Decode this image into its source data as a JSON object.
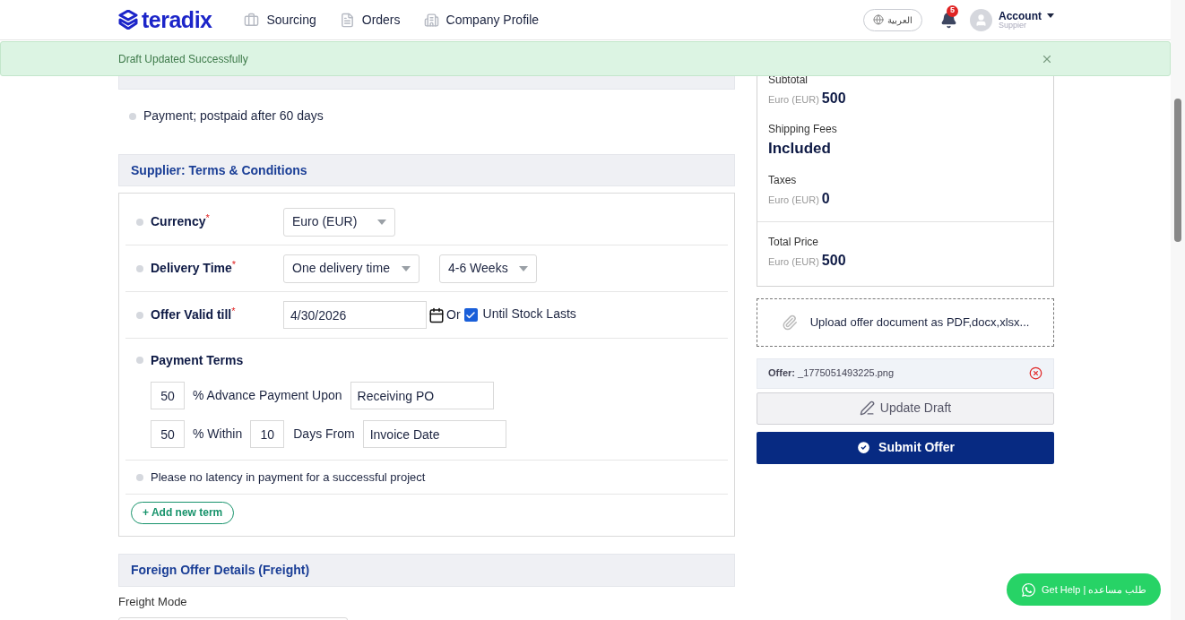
{
  "nav": {
    "brand": "teradix",
    "links": [
      {
        "label": "Sourcing",
        "kind": "briefcase"
      },
      {
        "label": "Orders",
        "kind": "document"
      },
      {
        "label": "Company Profile",
        "kind": "building"
      }
    ],
    "language": "العربية",
    "notifications": "5",
    "account": {
      "name": "Account",
      "role": "Suppier"
    }
  },
  "toast": {
    "message": "Draft Updated Successfully"
  },
  "payment_note": "Payment; postpaid after 60 days",
  "terms_section": {
    "title": "Supplier: Terms & Conditions",
    "currency": {
      "label": "Currency",
      "required_mark": "*",
      "value": "Euro (EUR)"
    },
    "delivery": {
      "label": "Delivery Time",
      "required_mark": "*",
      "values": [
        "One delivery time",
        "4-6 Weeks"
      ]
    },
    "valid_till": {
      "label": "Offer Valid till",
      "required_mark": "*",
      "value": "4/30/2026",
      "or": "Or",
      "until_stock": {
        "label": "Until Stock Lasts",
        "checked": true
      }
    },
    "payment_terms": {
      "label": "Payment Terms",
      "advance": {
        "percent": "50",
        "text": "% Advance Payment Upon",
        "event": "Receiving PO"
      },
      "balance": {
        "percent": "50",
        "text": "% Within",
        "days": "10",
        "days_text": "Days From",
        "event": "Invoice Date"
      }
    },
    "extra_terms": [
      "Please no latency in payment for a successful project"
    ],
    "add_button": "+ Add new term"
  },
  "freight_section": {
    "title": "Foreign Offer Details (Freight)",
    "field_label": "Freight Mode"
  },
  "summary": {
    "items": [
      {
        "label": "Subtotal",
        "currency": "Euro (EUR)",
        "amount": "500"
      },
      {
        "label": "Shipping Fees",
        "amount": "Included"
      },
      {
        "label": "Taxes",
        "currency": "Euro (EUR)",
        "amount": "0"
      }
    ],
    "total": {
      "label": "Total Price",
      "currency": "Euro (EUR)",
      "amount": "500"
    }
  },
  "upload": "Upload offer document as PDF,docx,xlsx...",
  "attachment": {
    "label": "Offer:",
    "file": "_1775051493225.png"
  },
  "update_button": "Update Draft",
  "submit_button": "Submit Offer",
  "help_button": "Get Help | طلب مساعده"
}
